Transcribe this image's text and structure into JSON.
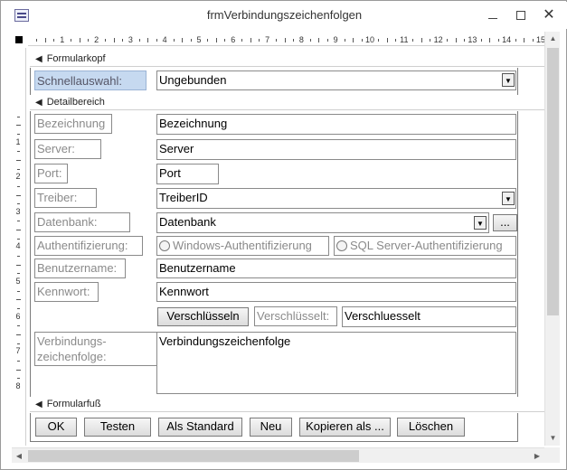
{
  "window": {
    "title": "frmVerbindungszeichenfolgen",
    "min_glyph": "—",
    "close_glyph": "✕"
  },
  "ruler": {
    "numbers": [
      "1",
      "2",
      "3",
      "4",
      "5",
      "6",
      "7",
      "8",
      "9",
      "10",
      "11",
      "12",
      "13",
      "14",
      "15"
    ],
    "vnumbers": [
      "1",
      "2",
      "3",
      "4",
      "5",
      "6",
      "7",
      "8"
    ]
  },
  "sections": {
    "header": "Formularkopf",
    "detail": "Detailbereich",
    "footer": "Formularfuß",
    "arrow_glyph": "◀"
  },
  "header": {
    "quick_label": "Schnellauswahl:",
    "quick_value": "Ungebunden"
  },
  "detail": {
    "bezeichnung_label": "Bezeichnung",
    "bezeichnung_value": "Bezeichnung",
    "server_label": "Server:",
    "server_value": "Server",
    "port_label": "Port:",
    "port_value": "Port",
    "treiber_label": "Treiber:",
    "treiber_value": "TreiberID",
    "datenbank_label": "Datenbank:",
    "datenbank_value": "Datenbank",
    "browse_label": "...",
    "auth_label": "Authentifizierung:",
    "auth_windows": "Windows-Authentifizierung",
    "auth_sql": "SQL Server-Authentifizierung",
    "user_label": "Benutzername:",
    "user_value": "Benutzername",
    "pw_label": "Kennwort:",
    "pw_value": "Kennwort",
    "encrypt_button": "Verschlüsseln",
    "encrypted_label": "Verschlüsselt:",
    "encrypted_value": "Verschluesselt",
    "conn_label_line1": "Verbindungs-",
    "conn_label_line2": "zeichenfolge:",
    "conn_value": "Verbindungszeichenfolge"
  },
  "footer": {
    "ok": "OK",
    "test": "Testen",
    "default": "Als Standard",
    "new": "Neu",
    "copy": "Kopieren als ...",
    "delete": "Löschen"
  },
  "glyphs": {
    "dropdown": "▼",
    "up": "▲",
    "down": "▼",
    "left": "◀",
    "right": "▶"
  }
}
